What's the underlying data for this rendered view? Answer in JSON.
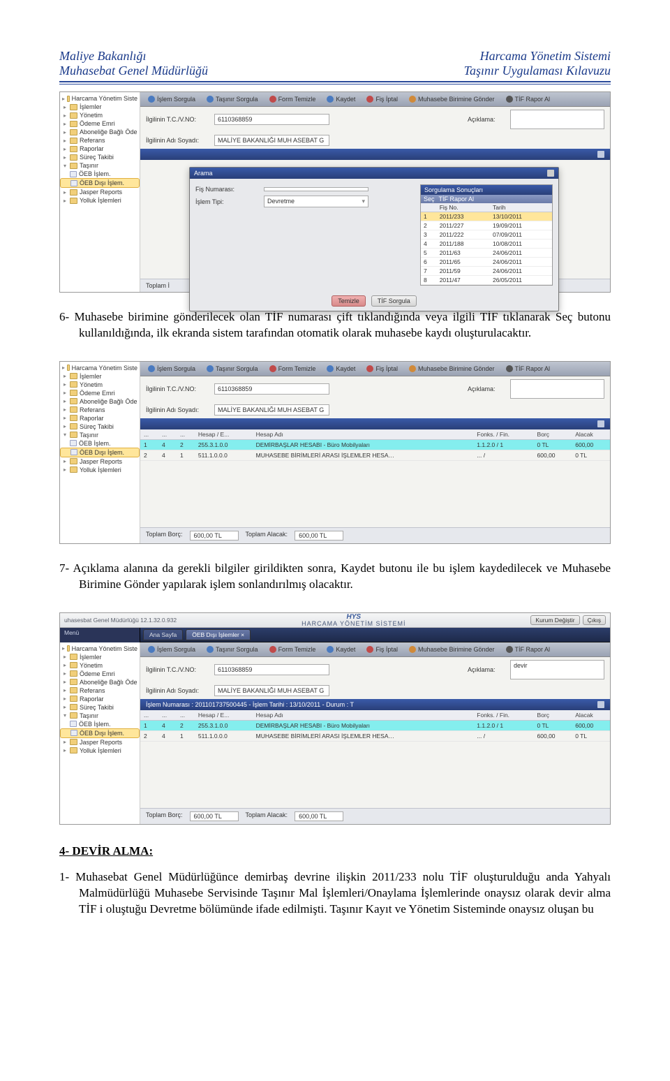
{
  "header": {
    "left1": "Maliye Bakanlığı",
    "left2": "Muhasebat Genel Müdürlüğü",
    "right1": "Harcama Yönetim Sistemi",
    "right2": "Taşınır Uygulaması Kılavuzu"
  },
  "tree": {
    "root": "Harcama Yönetim Siste",
    "islemler": "İşlemler",
    "yonetim": "Yönetim",
    "odeme": "Ödeme Emri",
    "abonelik": "Aboneliğe Bağlı Öde",
    "referans": "Referans",
    "raporlar": "Raporlar",
    "surec": "Süreç Takibi",
    "tasinir": "Taşınır",
    "oeb": "ÖEB İşlem.",
    "oebdisi": "ÖEB Dışı İşlem.",
    "jasper": "Jasper Reports",
    "yolluk": "Yolluk İşlemleri"
  },
  "toolbar": {
    "islemSorgula": "İşlem Sorgula",
    "tasinirSorgula": "Taşınır Sorgula",
    "formTemizle": "Form Temizle",
    "kaydet": "Kaydet",
    "fisIptal": "Fiş İptal",
    "muhasebeGonder": "Muhasebe Birimine Gönder",
    "tifRapor": "TİF Rapor Al"
  },
  "form": {
    "tcvknoLabel": "İlgilinin T.C./V.NO:",
    "tcvknoVal": "6110368859",
    "adsoyadLabel": "İlgilinin Adı Soyadı:",
    "adsoyadVal": "MALİYE BAKANLIĞI MUH ASEBAT G",
    "aciklamaLabel": "Açıklama:",
    "aciklamaVal3": "devir"
  },
  "popup": {
    "title": "Arama",
    "fisNoLabel": "Fiş Numarası:",
    "islemTipLabel": "İşlem Tipi:",
    "islemTipVal": "Devretme",
    "sonucTitle": "Sorgulama Sonuçları",
    "sec": "Seç",
    "tifRapor": "TİF Rapor Al",
    "colFisNo": "Fiş No.",
    "colTarih": "Tarih",
    "rows": [
      {
        "n": "1",
        "fis": "2011/233",
        "tar": "13/10/2011"
      },
      {
        "n": "2",
        "fis": "2011/227",
        "tar": "19/09/2011"
      },
      {
        "n": "3",
        "fis": "2011/222",
        "tar": "07/09/2011"
      },
      {
        "n": "4",
        "fis": "2011/188",
        "tar": "10/08/2011"
      },
      {
        "n": "5",
        "fis": "2011/63",
        "tar": "24/06/2011"
      },
      {
        "n": "6",
        "fis": "2011/65",
        "tar": "24/06/2011"
      },
      {
        "n": "7",
        "fis": "2011/59",
        "tar": "24/06/2011"
      },
      {
        "n": "8",
        "fis": "2011/47",
        "tar": "26/05/2011"
      }
    ],
    "temizle": "Temizle",
    "tifSorgula": "TİF Sorgula"
  },
  "totals": {
    "toplamLabel": "Toplam İ",
    "borcLabel": "Toplam Borç:",
    "alacakLabel": "Toplam Alacak:",
    "val": "600,00 TL"
  },
  "tableCols": {
    "hesap": "Hesap / E...",
    "hesapAdi": "Hesap Adı",
    "fonks": "Fonks. / Fin.",
    "borc": "Borç",
    "alacak": "Alacak"
  },
  "tableRows": [
    {
      "a": "1",
      "b": "4",
      "c": "2",
      "hesap": "255.3.1.0.0",
      "adi": "DEMİRBAŞLAR HESABI - Büro Mobilyaları",
      "fonks": "1.1.2.0 / 1",
      "borc": "0 TL",
      "alacak": "600,00"
    },
    {
      "a": "2",
      "b": "4",
      "c": "1",
      "hesap": "511.1.0.0.0",
      "adi": "MUHASEBE BİRİMLERİ ARASI İŞLEMLER HESA…",
      "fonks": "... /",
      "borc": "600,00",
      "alacak": "0 TL"
    }
  ],
  "blueBar": {
    "islemNumarasi": "İşlem Numarası : 201101737500445 - İşlem Tarihi : 13/10/2011 - Durum : T"
  },
  "hys": {
    "left": "uhasesbat Genel Müdürlüğü 12.1.32.0.932",
    "brand": "HYS",
    "sub": "HARCAMA YÖNETİM SİSTEMİ",
    "kurumDeg": "Kurum Değiştir",
    "cikis": "Çıkış",
    "menu": "Menü",
    "tab1": "Ana Sayfa",
    "tab2": "ÖEB Dışı İşlemler"
  },
  "para6": "6- Muhasebe birimine gönderilecek olan TİF numarası çift tıklandığında veya ilgili TİF tıklanarak Seç butonu kullanıldığında, ilk ekranda sistem tarafından otomatik olarak muhasebe kaydı oluşturulacaktır.",
  "para7": "7- Açıklama alanına da gerekli bilgiler girildikten sonra, Kaydet butonu ile bu işlem kaydedilecek ve Muhasebe Birimine Gönder yapılarak işlem sonlandırılmış olacaktır.",
  "sectionTitle": "4- DEVİR ALMA:",
  "para4_1": "1- Muhasebat Genel Müdürlüğünce demirbaş devrine ilişkin 2011/233 nolu TİF oluşturulduğu anda Yahyalı Malmüdürlüğü Muhasebe Servisinde Taşınır Mal İşlemleri/Onaylama İşlemlerinde onaysız olarak devir alma TİF i oluştuğu Devretme bölümünde ifade edilmişti. Taşınır Kayıt ve Yönetim Sisteminde onaysız oluşan bu"
}
